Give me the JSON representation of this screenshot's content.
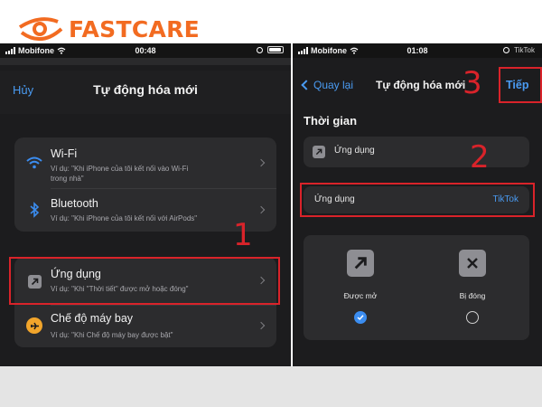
{
  "brand": {
    "name": "FASTCARE",
    "accent": "#f26b21"
  },
  "left_screen": {
    "status": {
      "carrier": "Mobifone",
      "time": "00:48"
    },
    "nav": {
      "cancel": "Hủy",
      "title": "Tự động hóa mới"
    },
    "triggers": [
      {
        "icon": "wifi-icon",
        "title": "Wi-Fi",
        "subtitle_line1": "Ví dụ: \"Khi iPhone của tôi kết nối vào Wi-Fi",
        "subtitle_line2": "trong nhà\""
      },
      {
        "icon": "bluetooth-icon",
        "title": "Bluetooth",
        "subtitle_line1": "Ví dụ: \"Khi iPhone của tôi kết nối với AirPods\""
      }
    ],
    "app_trigger": {
      "icon": "app-arrow-icon",
      "title": "Ứng dụng",
      "subtitle": "Ví dụ: \"Khi \"Thời tiết\" được mở hoặc đóng\""
    },
    "airplane_trigger": {
      "icon": "airplane-icon",
      "title": "Chế độ máy bay",
      "subtitle": "Ví dụ: \"Khi Chế độ máy bay được bật\""
    },
    "step_number": "1"
  },
  "right_screen": {
    "status": {
      "carrier": "Mobifone",
      "time": "01:08",
      "app_tag": "TikTok"
    },
    "nav": {
      "back": "Quay lại",
      "title": "Tự động hóa mới",
      "next": "Tiếp"
    },
    "section_title": "Thời gian",
    "app_row_label": "Ứng dụng",
    "selection": {
      "label": "Ứng dụng",
      "value": "TikTok"
    },
    "options": [
      {
        "label": "Được mở",
        "selected": true
      },
      {
        "label": "Bị đóng",
        "selected": false
      }
    ],
    "step_numbers": {
      "next": "3",
      "selection": "2"
    }
  }
}
